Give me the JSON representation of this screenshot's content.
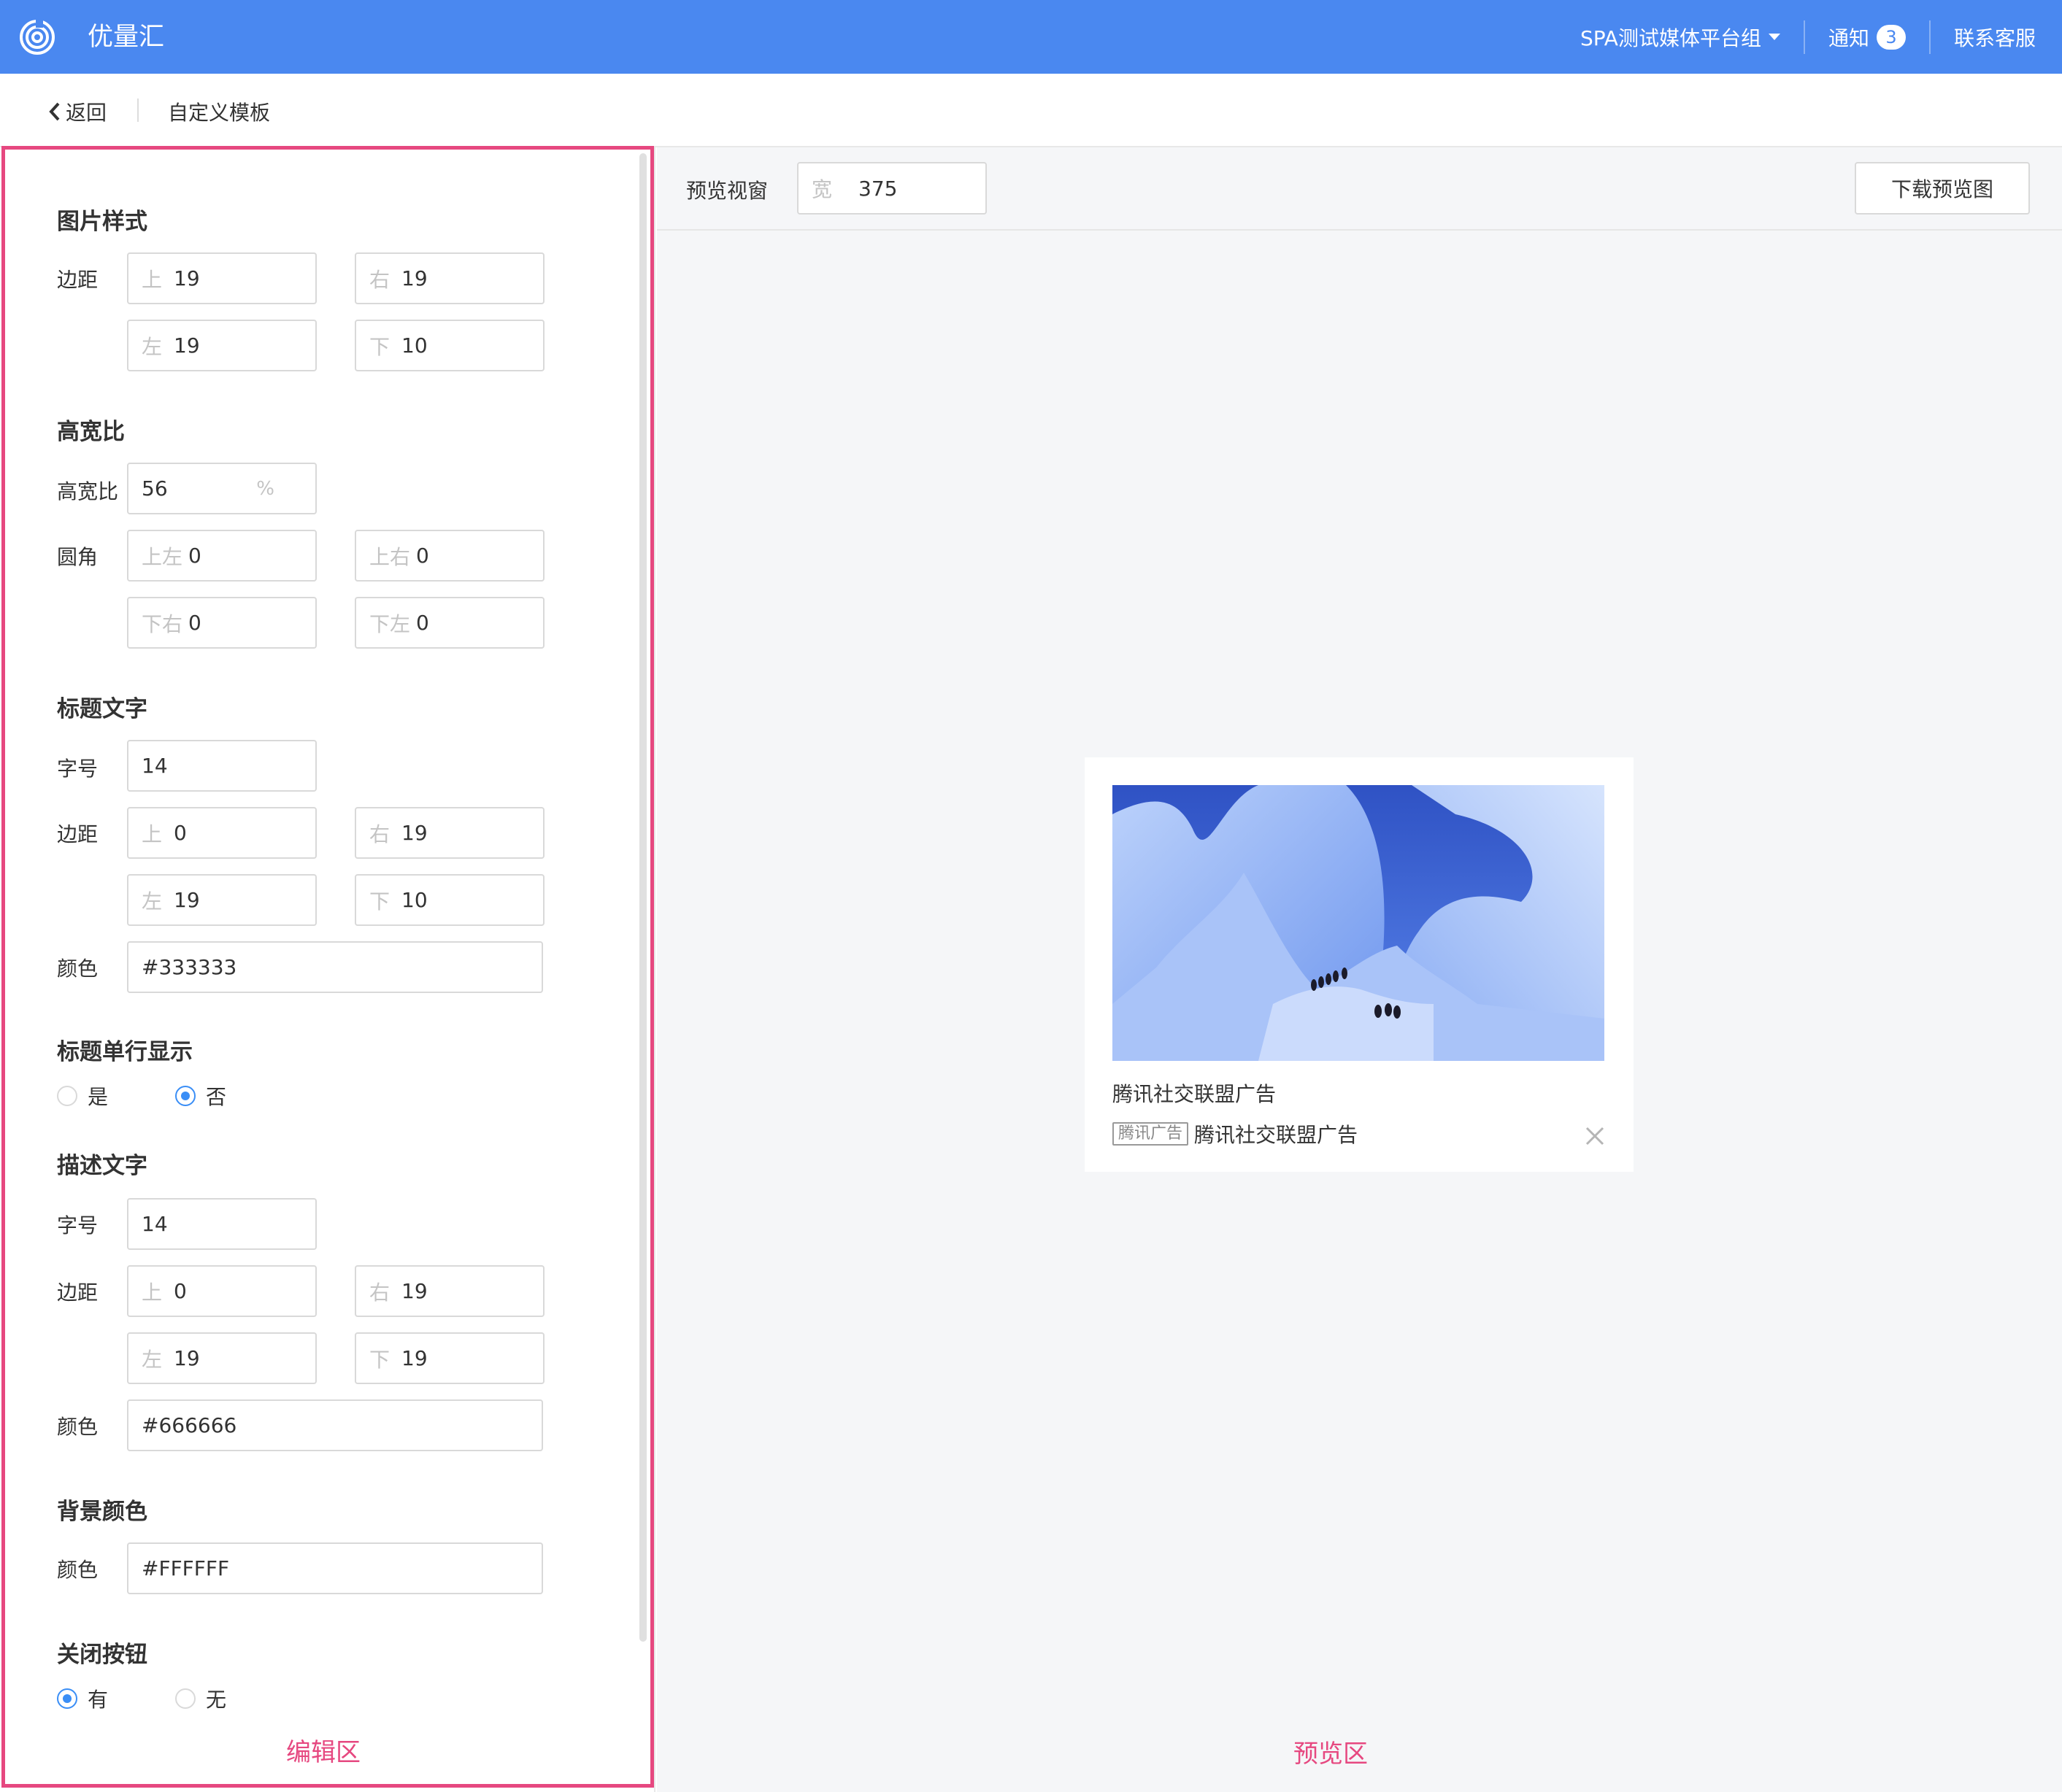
{
  "header": {
    "brand": "优量汇",
    "org": "SPA测试媒体平台组",
    "notice_label": "通知",
    "notice_count": "3",
    "support": "联系客服",
    "accent": "#4a88f0"
  },
  "breadcrumb": {
    "back": "返回",
    "title": "自定义模板"
  },
  "editor": {
    "image_style": {
      "title": "图片样式",
      "margin_label": "边距",
      "top": {
        "prefix": "上",
        "value": "19"
      },
      "right": {
        "prefix": "右",
        "value": "19"
      },
      "left": {
        "prefix": "左",
        "value": "19"
      },
      "bottom": {
        "prefix": "下",
        "value": "10"
      }
    },
    "aspect": {
      "title": "高宽比",
      "ratio_label": "高宽比",
      "ratio_value": "56",
      "ratio_suffix": "%",
      "radius_label": "圆角",
      "tl": {
        "prefix": "上左",
        "value": "0"
      },
      "tr": {
        "prefix": "上右",
        "value": "0"
      },
      "br": {
        "prefix": "下右",
        "value": "0"
      },
      "bl": {
        "prefix": "下左",
        "value": "0"
      }
    },
    "title_text": {
      "title": "标题文字",
      "size_label": "字号",
      "size_value": "14",
      "margin_label": "边距",
      "top": {
        "prefix": "上",
        "value": "0"
      },
      "right": {
        "prefix": "右",
        "value": "19"
      },
      "left": {
        "prefix": "左",
        "value": "19"
      },
      "bottom": {
        "prefix": "下",
        "value": "10"
      },
      "color_label": "颜色",
      "color_value": "#333333"
    },
    "single_line": {
      "title": "标题单行显示",
      "yes": "是",
      "no": "否",
      "selected": "否"
    },
    "desc_text": {
      "title": "描述文字",
      "size_label": "字号",
      "size_value": "14",
      "margin_label": "边距",
      "top": {
        "prefix": "上",
        "value": "0"
      },
      "right": {
        "prefix": "右",
        "value": "19"
      },
      "left": {
        "prefix": "左",
        "value": "19"
      },
      "bottom": {
        "prefix": "下",
        "value": "19"
      },
      "color_label": "颜色",
      "color_value": "#666666"
    },
    "background": {
      "title": "背景颜色",
      "color_label": "颜色",
      "color_value": "#FFFFFF"
    },
    "close_button": {
      "title": "关闭按钮",
      "yes": "有",
      "no": "无",
      "selected": "有"
    },
    "zone_label": "编辑区"
  },
  "preview": {
    "viewport_label": "预览视窗",
    "width_prefix": "宽",
    "width_value": "375",
    "download_label": "下载预览图",
    "ad_title": "腾讯社交联盟广告",
    "ad_tag": "腾讯广告",
    "ad_desc": "腾讯社交联盟广告",
    "zone_label": "预览区"
  },
  "colors": {
    "highlight": "#e64880",
    "radio_on": "#3a8ef6"
  }
}
